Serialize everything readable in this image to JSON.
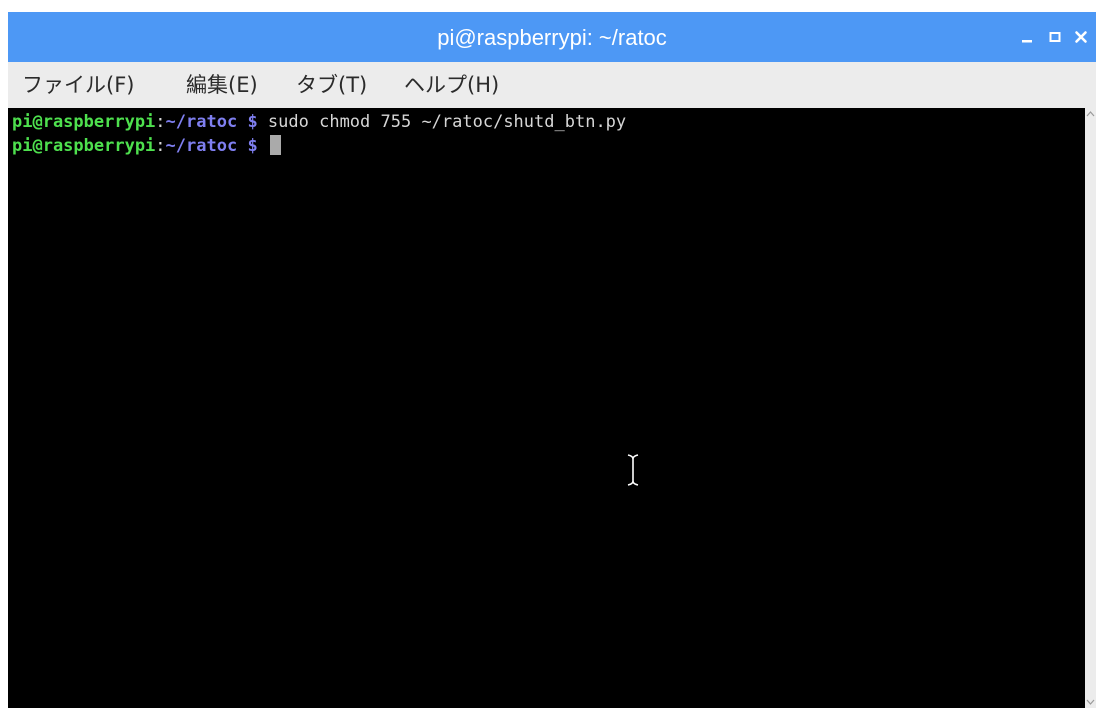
{
  "window": {
    "title": "pi@raspberrypi: ~/ratoc",
    "titlebar_color": "#4d98f5",
    "controls": {
      "minimize_icon": "minimize-icon",
      "maximize_icon": "maximize-icon",
      "close_icon": "close-icon"
    }
  },
  "menubar": {
    "items": [
      {
        "label": "ファイル(F)"
      },
      {
        "label": "編集(E)"
      },
      {
        "label": "タブ(T)"
      },
      {
        "label": "ヘルプ(H)"
      }
    ]
  },
  "terminal": {
    "background": "#000000",
    "prompt_user_color": "#4ee04e",
    "prompt_path_color": "#7f7ff0",
    "lines": [
      {
        "user_host": "pi@raspberrypi",
        "sep": ":",
        "path": "~/ratoc",
        "dollar": " $",
        "command": " sudo chmod 755 ~/ratoc/shutd_btn.py"
      },
      {
        "user_host": "pi@raspberrypi",
        "sep": ":",
        "path": "~/ratoc",
        "dollar": " $",
        "command": " "
      }
    ],
    "mouse_cursor_icon": "text-cursor-icon"
  }
}
